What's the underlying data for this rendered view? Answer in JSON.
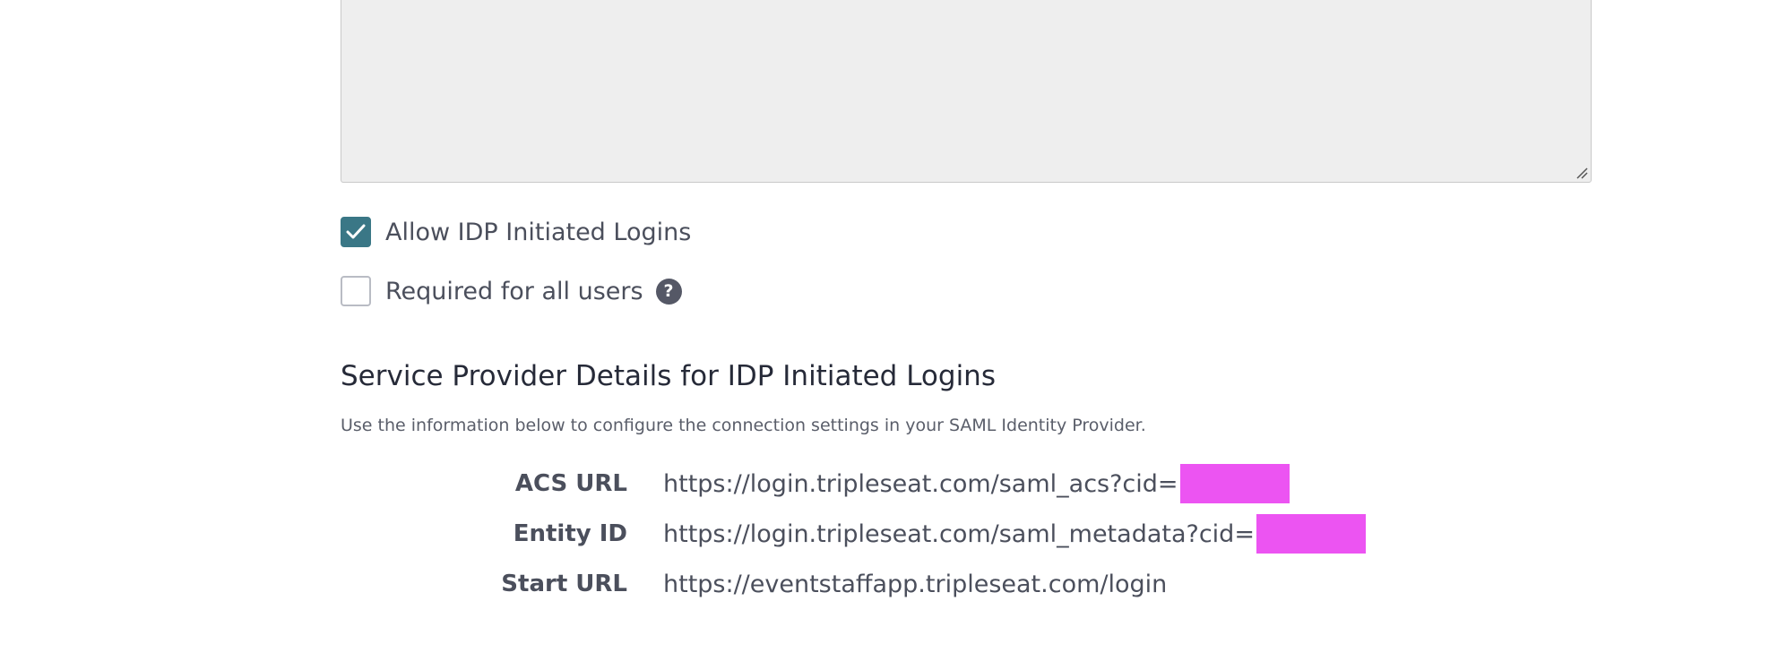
{
  "form": {
    "allow_idp": {
      "label": "Allow IDP Initiated Logins",
      "checked": true
    },
    "required_all": {
      "label": "Required for all users",
      "checked": false
    }
  },
  "service_provider": {
    "title": "Service Provider Details for IDP Initiated Logins",
    "description": "Use the information below to configure the connection settings in your SAML Identity Provider.",
    "rows": [
      {
        "key": "ACS URL",
        "value": "https://login.tripleseat.com/saml_acs?cid="
      },
      {
        "key": "Entity ID",
        "value": "https://login.tripleseat.com/saml_metadata?cid="
      },
      {
        "key": "Start URL",
        "value": "https://eventstaffapp.tripleseat.com/login"
      }
    ]
  },
  "colors": {
    "checkbox_checked": "#3a7786",
    "redaction": "#ec54f2",
    "textarea_bg": "#eeeeee"
  }
}
